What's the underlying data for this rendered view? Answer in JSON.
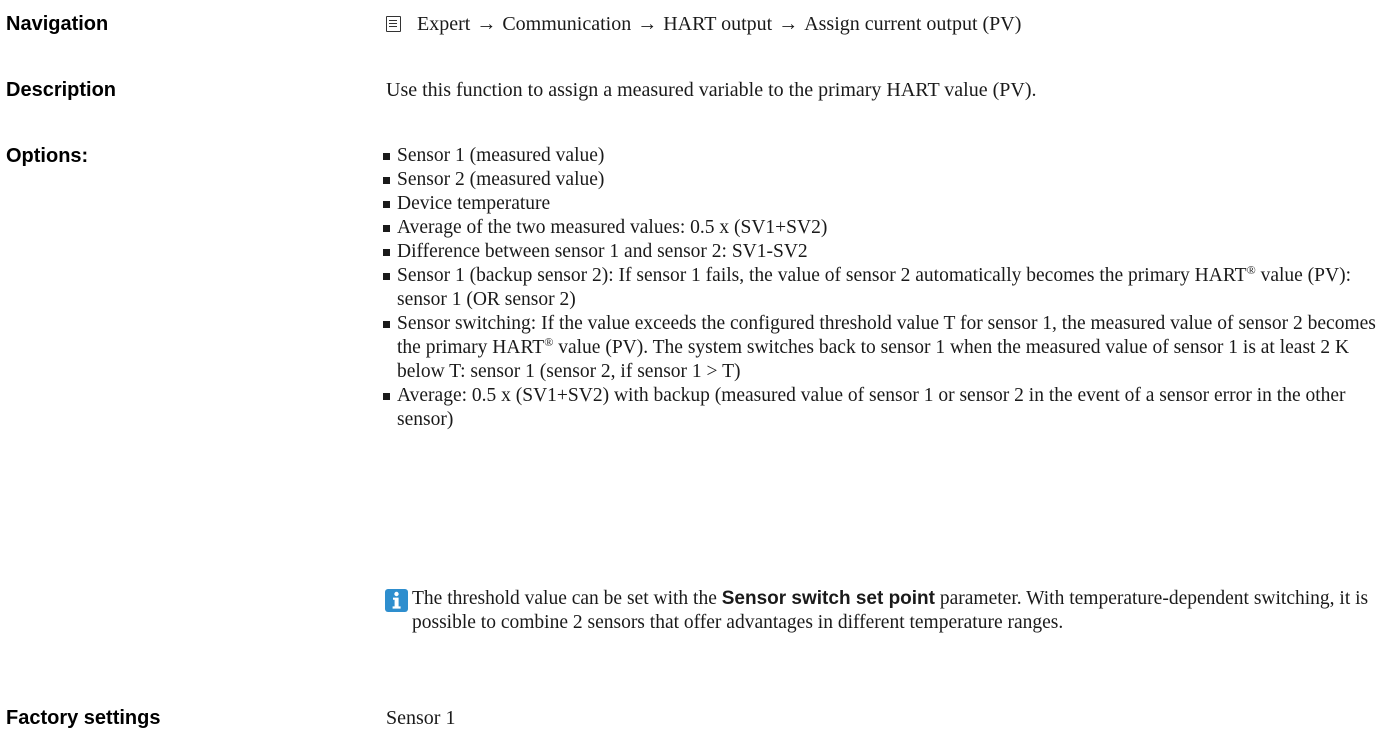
{
  "navigation": {
    "label": "Navigation",
    "icon": "display-icon",
    "path": [
      "Expert",
      "Communication",
      "HART output",
      "Assign current output (PV)"
    ],
    "separator": "→"
  },
  "description": {
    "label": "Description",
    "text": "Use this function to assign a measured variable to the primary HART value (PV)."
  },
  "options": {
    "label": "Options:",
    "items": [
      "Sensor 1 (measured value)",
      "Sensor 2 (measured value)",
      "Device temperature",
      "Average of the two measured values: 0.5 x (SV1+SV2)",
      "Difference between sensor 1 and sensor 2: SV1-SV2",
      "Sensor 1 (backup sensor 2): If sensor 1 fails, the value of sensor 2 automatically becomes the primary HART® value (PV): sensor 1 (OR sensor 2)",
      "Sensor switching: If the value exceeds the configured threshold value T for sensor 1, the measured value of sensor 2 becomes the primary HART® value (PV). The system switches back to sensor 1 when the measured value of sensor 1 is at least 2 K below T: sensor 1 (sensor 2, if sensor 1 > T)",
      "Average: 0.5 x (SV1+SV2) with backup (measured value of sensor 1 or sensor 2 in the event of a sensor error in the other sensor)"
    ]
  },
  "note": {
    "icon": "info-icon",
    "text_before": "The threshold value can be set with the ",
    "parameter": "Sensor switch set point",
    "text_after": " parameter. With temperature-dependent switching, it is possible to combine 2 sensors that offer advantages in different temperature ranges.",
    "icon_color": "#2e8ece"
  },
  "factory_settings": {
    "label": "Factory settings",
    "value": "Sensor 1"
  }
}
